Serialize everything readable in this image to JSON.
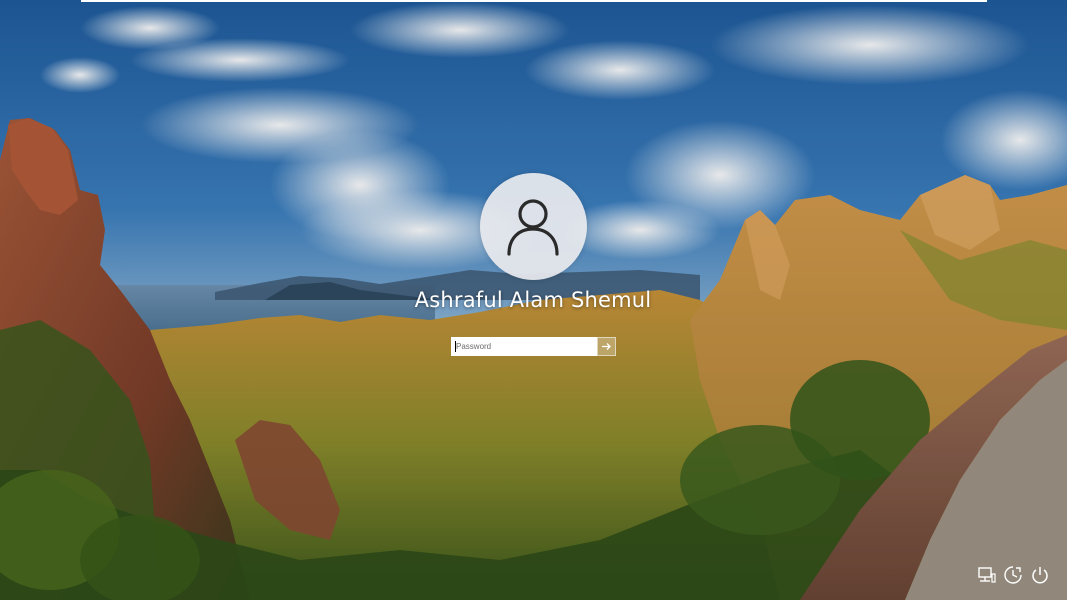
{
  "lock_screen": {
    "user": {
      "name": "Ashraful Alam Shemul",
      "avatar_icon": "user-icon"
    },
    "password": {
      "placeholder": "Password",
      "value": "",
      "submit_icon": "arrow-right-icon"
    },
    "corner_buttons": [
      {
        "name": "network",
        "icon": "network-icon"
      },
      {
        "name": "ease-of-access",
        "icon": "ease-of-access-icon"
      },
      {
        "name": "power",
        "icon": "power-icon"
      }
    ]
  },
  "colors": {
    "sky": "#2f6db0",
    "text": "#ffffff",
    "avatar_bg": "#e8eaee",
    "input_bg": "#ffffff"
  }
}
